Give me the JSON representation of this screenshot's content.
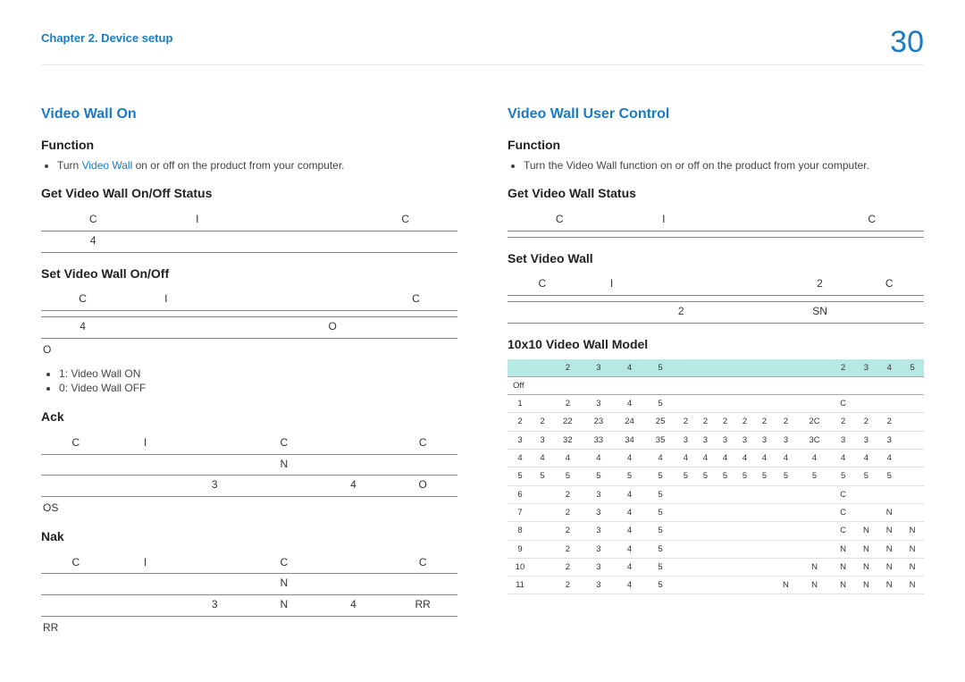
{
  "header": {
    "chapter": "Chapter 2. Device setup",
    "page_number": "30"
  },
  "left": {
    "title": "Video Wall On",
    "function_label": "Function",
    "function_pre": "Turn ",
    "function_link": "Video Wall",
    "function_post": " on or off on the product from your computer.",
    "get_label": "Get Video Wall On/Off Status",
    "get_r1": [
      "C",
      "I",
      "",
      "C"
    ],
    "get_r2": [
      "4",
      "",
      "",
      ""
    ],
    "set_label": "Set Video Wall On/Off",
    "set_r1": [
      "C",
      "I",
      "",
      "",
      "C"
    ],
    "set_r2": [
      "",
      "",
      "",
      "",
      ""
    ],
    "set_r3": [
      "4",
      "",
      "",
      "O",
      ""
    ],
    "o_label": "O",
    "o_bullets": [
      "1: Video Wall ON",
      "0: Video Wall OFF"
    ],
    "ack_label": "Ack",
    "ack_r1": [
      "C",
      "I",
      "",
      "C",
      "",
      "C"
    ],
    "ack_r2": [
      "",
      "",
      "",
      "N",
      "",
      ""
    ],
    "ack_r3": [
      "",
      "",
      "3",
      "",
      "4",
      "O"
    ],
    "os_label": "OS",
    "nak_label": "Nak",
    "nak_r1": [
      "C",
      "I",
      "",
      "C",
      "",
      "C"
    ],
    "nak_r2": [
      "",
      "",
      "",
      "N",
      "",
      ""
    ],
    "nak_r3": [
      "",
      "",
      "3",
      "N",
      "4",
      "RR"
    ],
    "rr_label": "RR"
  },
  "right": {
    "title": "Video Wall User Control",
    "function_label": "Function",
    "function_text": "Turn the Video Wall function on or off on the product from your computer.",
    "get_label": "Get Video Wall Status",
    "get_r1": [
      "C",
      "I",
      "",
      "C"
    ],
    "get_r2": [
      "",
      "",
      "",
      ""
    ],
    "set_label": "Set Video Wall",
    "set_r1": [
      "C",
      "I",
      "",
      "",
      "2",
      "C"
    ],
    "set_r2": [
      "",
      "",
      "",
      "",
      "",
      ""
    ],
    "set_r3": [
      "",
      "",
      "2",
      "",
      "SN",
      ""
    ],
    "model_label": "10x10 Video Wall Model",
    "model_header": [
      "",
      "",
      "2",
      "3",
      "4",
      "5",
      "",
      "",
      "",
      "",
      "",
      "",
      "",
      "2",
      "3",
      "4",
      "5"
    ],
    "model_off": "Off",
    "model_rows": [
      [
        "1",
        "",
        "2",
        "3",
        "4",
        "5",
        "",
        "",
        "",
        "",
        "",
        "",
        "",
        "C",
        "",
        "",
        ""
      ],
      [
        "2",
        "2",
        "22",
        "23",
        "24",
        "25",
        "2",
        "2",
        "2",
        "2",
        "2",
        "2",
        "2C",
        "2",
        "2",
        "2",
        ""
      ],
      [
        "3",
        "3",
        "32",
        "33",
        "34",
        "35",
        "3",
        "3",
        "3",
        "3",
        "3",
        "3",
        "3C",
        "3",
        "3",
        "3",
        ""
      ],
      [
        "4",
        "4",
        "4",
        "4",
        "4",
        "4",
        "4",
        "4",
        "4",
        "4",
        "4",
        "4",
        "4",
        "4",
        "4",
        "4",
        ""
      ],
      [
        "5",
        "5",
        "5",
        "5",
        "5",
        "5",
        "5",
        "5",
        "5",
        "5",
        "5",
        "5",
        "5",
        "5",
        "5",
        "5",
        ""
      ],
      [
        "6",
        "",
        "2",
        "3",
        "4",
        "5",
        "",
        "",
        "",
        "",
        "",
        "",
        "",
        "C",
        "",
        "",
        ""
      ],
      [
        "7",
        "",
        "2",
        "3",
        "4",
        "5",
        "",
        "",
        "",
        "",
        "",
        "",
        "",
        "C",
        "",
        "N",
        ""
      ],
      [
        "8",
        "",
        "2",
        "3",
        "4",
        "5",
        "",
        "",
        "",
        "",
        "",
        "",
        "",
        "C",
        "N",
        "N",
        "N"
      ],
      [
        "9",
        "",
        "2",
        "3",
        "4",
        "5",
        "",
        "",
        "",
        "",
        "",
        "",
        "",
        "N",
        "N",
        "N",
        "N"
      ],
      [
        "10",
        "",
        "2",
        "3",
        "4",
        "5",
        "",
        "",
        "",
        "",
        "",
        "",
        "N",
        "N",
        "N",
        "N",
        "N"
      ],
      [
        "11",
        "",
        "2",
        "3",
        "4",
        "5",
        "",
        "",
        "",
        "",
        "",
        "N",
        "N",
        "N",
        "N",
        "N",
        "N"
      ]
    ]
  }
}
